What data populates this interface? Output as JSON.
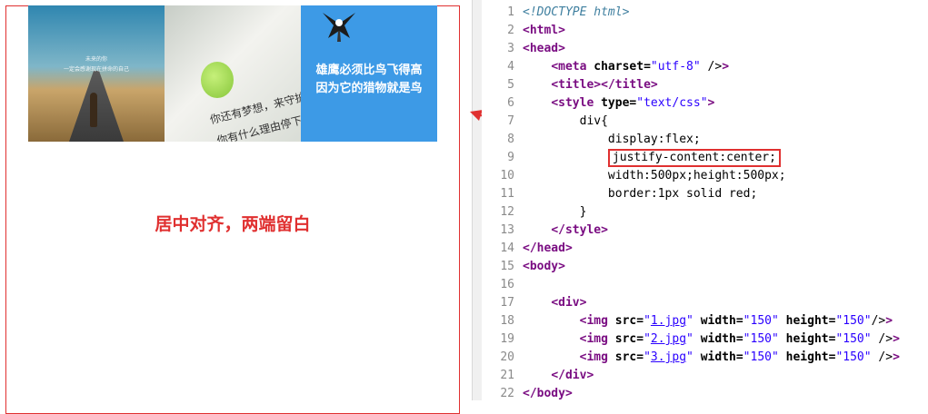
{
  "preview": {
    "images": [
      {
        "file": "1.jpg",
        "text_lines": [
          "未来的你",
          "一定会感谢现在拼命的自己"
        ]
      },
      {
        "file": "2.jpg",
        "text_lines": [
          "你还有梦想，来守护你的梦",
          "你有什么理由停下脚步"
        ]
      },
      {
        "file": "3.jpg",
        "text_lines": [
          "雄鹰必须比鸟飞得高",
          "因为它的猎物就是鸟"
        ]
      }
    ],
    "caption": "居中对齐，两端留白",
    "box_border_color": "#e03030"
  },
  "editor": {
    "line_numbers": [
      "1",
      "2",
      "3",
      "4",
      "5",
      "6",
      "7",
      "8",
      "9",
      "10",
      "11",
      "12",
      "13",
      "14",
      "15",
      "16",
      "17",
      "18",
      "19",
      "20",
      "21",
      "22"
    ],
    "doctype": "<!DOCTYPE html>",
    "html_open": "html",
    "head_open": "head",
    "meta": {
      "tag": "meta",
      "attr": "charset=",
      "value": "\"utf-8\"",
      "close": " />"
    },
    "title": {
      "open": "title",
      "close": "/title"
    },
    "style": {
      "tag": "style",
      "attr": "type=",
      "value": "\"text/css\""
    },
    "css_lines": [
      "div{",
      "display:flex;",
      "justify-content:center;",
      "width:500px;height:500px;",
      "border:1px solid red;",
      "}"
    ],
    "style_close": "/style",
    "head_close": "/head",
    "body_open": "body",
    "div_open": "div",
    "img_lines": [
      {
        "src": "1.jpg",
        "width": "\"150\"",
        "height": "\"150\"",
        "end": "/>"
      },
      {
        "src": "2.jpg",
        "width": "\"150\"",
        "height": "\"150\"",
        "end": " />"
      },
      {
        "src": "3.jpg",
        "width": "\"150\"",
        "height": "\"150\"",
        "end": " />"
      }
    ],
    "div_close": "/div",
    "body_close": "/body"
  },
  "colors": {
    "accent": "#e03030",
    "tag": "#7a0d82",
    "string": "#2a00ff",
    "comment": "#3f7f9f"
  }
}
